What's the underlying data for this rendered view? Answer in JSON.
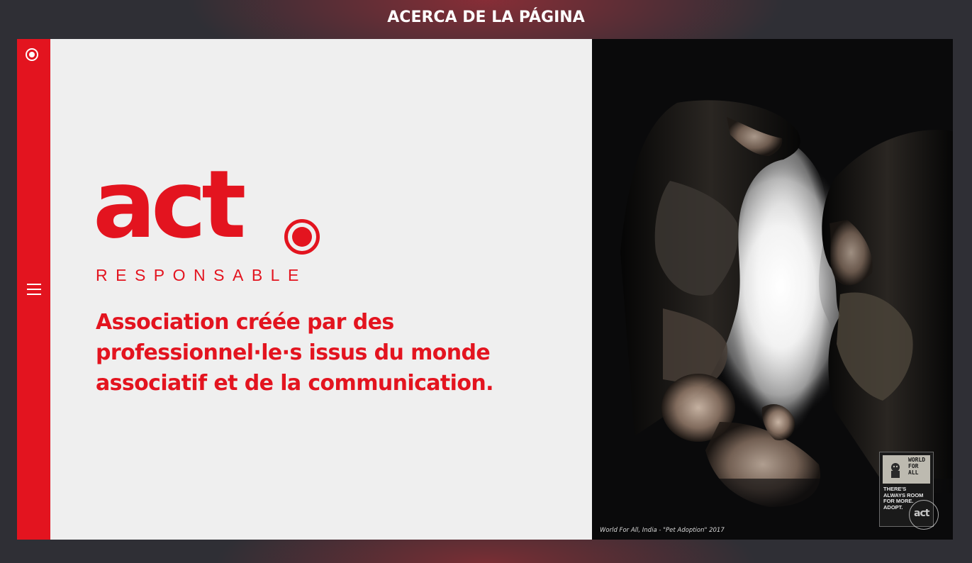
{
  "header": {
    "title": "ACERCA DE LA PÁGINA"
  },
  "brand": {
    "logo_word": "act",
    "logo_sub": "RESPONSABLE",
    "accent": "#e3141f",
    "rail_icon": "radio-dot-icon",
    "menu_icon": "hamburger-menu-icon"
  },
  "intro": {
    "tagline_lines": [
      "Association créée par des",
      "professionnel·le·s issus du monde",
      "associatif et de la communication."
    ]
  },
  "poster": {
    "caption": "World For All, India - \"Pet Adoption\" 2017",
    "card": {
      "logo_lines": [
        "WORLD",
        "FOR",
        "ALL"
      ],
      "slogan_lines": [
        "THERE'S",
        "ALWAYS ROOM",
        "FOR MORE.",
        "ADOPT."
      ]
    },
    "badge_text": "act"
  },
  "colors": {
    "background": "#2f2f35",
    "glow": "#962d37",
    "panel": "#efefef",
    "accent": "#e3141f"
  }
}
